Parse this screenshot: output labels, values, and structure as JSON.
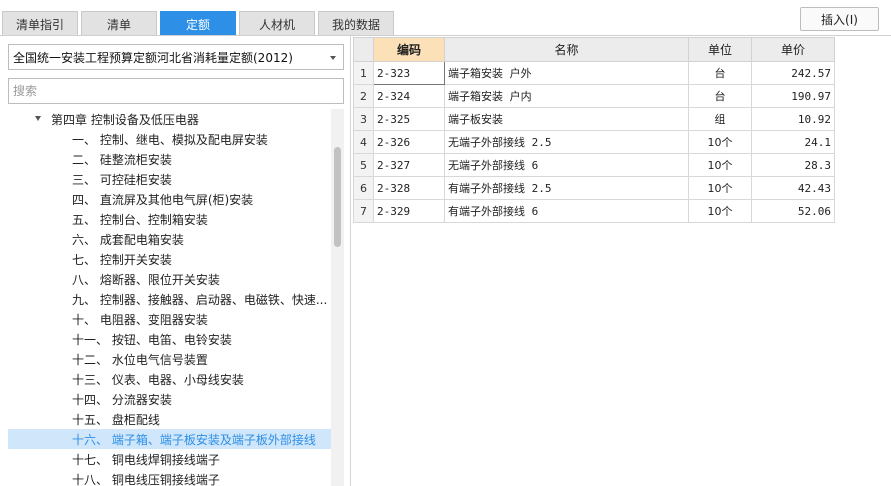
{
  "tabs": [
    {
      "label": "清单指引",
      "active": false
    },
    {
      "label": "清单",
      "active": false
    },
    {
      "label": "定额",
      "active": true
    },
    {
      "label": "人材机",
      "active": false
    },
    {
      "label": "我的数据",
      "active": false
    }
  ],
  "insert_button": "插入(I)",
  "colors": {
    "accent": "#2d8fe6",
    "selected_row_bg": "#cfe6fb",
    "code_header_bg": "#fbe0b8"
  },
  "left_panel": {
    "quota_select": "全国统一安装工程预算定额河北省消耗量定额(2012)",
    "search_placeholder": "搜索",
    "tree": [
      {
        "label": "第四章 控制设备及低压电器",
        "level": 0,
        "expanded": true,
        "selected": false
      },
      {
        "label": "一、 控制、继电、模拟及配电屏安装",
        "level": 1,
        "selected": false
      },
      {
        "label": "二、 硅整流柜安装",
        "level": 1,
        "selected": false
      },
      {
        "label": "三、 可控硅柜安装",
        "level": 1,
        "selected": false
      },
      {
        "label": "四、 直流屏及其他电气屏(柜)安装",
        "level": 1,
        "selected": false
      },
      {
        "label": "五、 控制台、控制箱安装",
        "level": 1,
        "selected": false
      },
      {
        "label": "六、 成套配电箱安装",
        "level": 1,
        "selected": false
      },
      {
        "label": "七、 控制开关安装",
        "level": 1,
        "selected": false
      },
      {
        "label": "八、 熔断器、限位开关安装",
        "level": 1,
        "selected": false
      },
      {
        "label": "九、 控制器、接触器、启动器、电磁铁、快速...",
        "level": 1,
        "selected": false
      },
      {
        "label": "十、 电阻器、变阻器安装",
        "level": 1,
        "selected": false
      },
      {
        "label": "十一、 按钮、电笛、电铃安装",
        "level": 1,
        "selected": false
      },
      {
        "label": "十二、 水位电气信号装置",
        "level": 1,
        "selected": false
      },
      {
        "label": "十三、 仪表、电器、小母线安装",
        "level": 1,
        "selected": false
      },
      {
        "label": "十四、 分流器安装",
        "level": 1,
        "selected": false
      },
      {
        "label": "十五、 盘柜配线",
        "level": 1,
        "selected": false
      },
      {
        "label": "十六、 端子箱、端子板安装及端子板外部接线",
        "level": 1,
        "selected": true
      },
      {
        "label": "十七、 铜电线焊铜接线端子",
        "level": 1,
        "selected": false
      },
      {
        "label": "十八、 铜电线压铜接线端子",
        "level": 1,
        "selected": false
      }
    ]
  },
  "grid": {
    "columns": [
      "",
      "编码",
      "名称",
      "单位",
      "单价"
    ],
    "rows": [
      {
        "no": "1",
        "code": "2-323",
        "name": "端子箱安装 户外",
        "unit": "台",
        "price": "242.57"
      },
      {
        "no": "2",
        "code": "2-324",
        "name": "端子箱安装 户内",
        "unit": "台",
        "price": "190.97"
      },
      {
        "no": "3",
        "code": "2-325",
        "name": "端子板安装",
        "unit": "组",
        "price": "10.92"
      },
      {
        "no": "4",
        "code": "2-326",
        "name": "无端子外部接线 2.5",
        "unit": "10个",
        "price": "24.1"
      },
      {
        "no": "5",
        "code": "2-327",
        "name": "无端子外部接线 6",
        "unit": "10个",
        "price": "28.3"
      },
      {
        "no": "6",
        "code": "2-328",
        "name": "有端子外部接线 2.5",
        "unit": "10个",
        "price": "42.43"
      },
      {
        "no": "7",
        "code": "2-329",
        "name": "有端子外部接线 6",
        "unit": "10个",
        "price": "52.06"
      }
    ]
  }
}
